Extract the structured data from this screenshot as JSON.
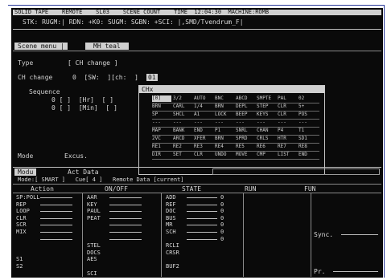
{
  "header": {
    "line1": "SOLID TAPE    REMOTE    SL03    SCENE COUNT    TIME  12:04:30  MACHINE:ROMB",
    "line2": "STK: RUGM:| RDN: +K0: SUGM: SGBN: +SCI: |,SMD/Tvendrum_F|"
  },
  "tabs": {
    "left": "Scene menu |",
    "right": "MH teal"
  },
  "form": {
    "type_label": "Type",
    "type_value": "[ CH change ]",
    "change_label": "CH change",
    "change_value": "0  [SW:  ][ch:  ]",
    "change_selected": "01",
    "sequence_label": "Sequence",
    "seq_rows": [
      "0 [ ]  [Hr]  [ ]",
      "0 [ ]  [Min]  [ ]"
    ],
    "mode_label": "Mode",
    "mode_value": "Excus."
  },
  "popup": {
    "title": "CHx",
    "rows": [
      [
        "[0]",
        "3/2",
        "AUTO",
        "BNC",
        "ABCD",
        "SMPTE",
        "PAL",
        "02"
      ],
      [
        "BRN",
        "CARL",
        "1/4",
        "BRN",
        "DEPL",
        "STEP",
        "CLR",
        "5+"
      ],
      [
        "SP",
        "SHCL",
        "A1",
        "LOCK",
        "BEEP",
        "KEYS",
        "CLR",
        "POS"
      ],
      [
        "---",
        "---",
        "---",
        "---",
        "---",
        "---",
        "---",
        "---"
      ],
      [
        "MAP",
        "BANK",
        "END",
        "P1",
        "SNRL",
        "CHAN",
        "P4",
        "T1"
      ],
      [
        "2VC",
        "ARCD",
        "XFER",
        "BRN",
        "SPRD",
        "CRLS",
        "HTR",
        "SD1"
      ],
      [
        "RE1",
        "RE2",
        "RE3",
        "RE4",
        "RE5",
        "RE6",
        "RE7",
        "RE8"
      ],
      [
        "DIR",
        "SET",
        "CLR",
        "UNDO",
        "MOVE",
        "CMP",
        "LIST",
        "END"
      ]
    ]
  },
  "lower": {
    "tab_a": "Modu",
    "tab_b": "Act Data",
    "subtab_line": "Mode:[ SMART ]   Cue[ 4 ]   Remote Data [current]",
    "col_headers": [
      "Action",
      "ON/OFF",
      "STATE",
      "RUN",
      "FUN"
    ],
    "rows": [
      {
        "name": "SP:POLL",
        "a": "AAR",
        "b": "ADD",
        "c": "0"
      },
      {
        "name": "REP",
        "a": "KEY",
        "b": "REF",
        "c": "0"
      },
      {
        "name": "LOOP",
        "a": "PAUL",
        "b": "DOC",
        "c": "0"
      },
      {
        "name": "CLR",
        "a": "PEAT",
        "b": "BUS",
        "c": "0"
      },
      {
        "name": "SCR",
        "a": "",
        "b": "MR",
        "c": "0"
      },
      {
        "name": "MIX",
        "a": "",
        "b": "SCH",
        "c": "0"
      },
      {
        "name": "",
        "a": "",
        "b": "",
        "c": "0"
      },
      {
        "name": "",
        "a": "STEL",
        "b": "RCLI",
        "c": ""
      },
      {
        "name": "",
        "a": "DOCS",
        "b": "CRSR",
        "c": ""
      },
      {
        "name": "S1",
        "a": "AES",
        "b": "",
        "c": ""
      },
      {
        "name": "S2",
        "a": "",
        "b": "BUF2",
        "c": ""
      },
      {
        "name": "",
        "a": "SCI",
        "b": "",
        "c": ""
      }
    ],
    "right_label_1": "Sync.",
    "right_label_2": "Pr."
  }
}
